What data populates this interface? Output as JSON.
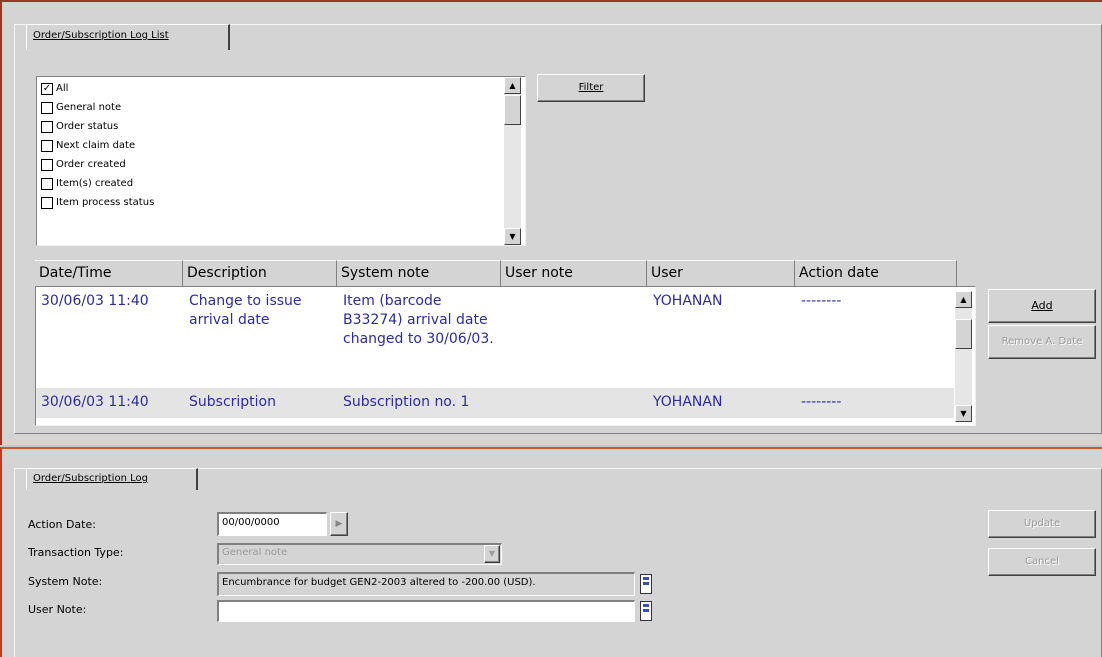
{
  "log_list": {
    "tab_label": "Order/Subscription Log List",
    "filter_button": "Filter",
    "filter_items": [
      {
        "label": "All",
        "checked": true
      },
      {
        "label": "General note",
        "checked": false
      },
      {
        "label": "Order status",
        "checked": false
      },
      {
        "label": "Next claim date",
        "checked": false
      },
      {
        "label": "Order created",
        "checked": false
      },
      {
        "label": "Item(s) created",
        "checked": false
      },
      {
        "label": "Item process status",
        "checked": false
      }
    ],
    "columns": [
      "Date/Time",
      "Description",
      "System note",
      "User note",
      "User",
      "Action date"
    ],
    "rows": [
      {
        "datetime": "30/06/03 11:40",
        "description": "Change to issue arrival date",
        "system_note": "Item (barcode B33274) arrival date changed to 30/06/03.",
        "user_note": "",
        "user": "YOHANAN",
        "action_date": "--------"
      },
      {
        "datetime": "30/06/03 11:40",
        "description": "Subscription",
        "system_note": "Subscription no. 1",
        "user_note": "",
        "user": "YOHANAN",
        "action_date": "--------"
      }
    ],
    "add_button": "Add",
    "remove_button": "Remove A. Date"
  },
  "log_form": {
    "tab_label": "Order/Subscription Log",
    "action_date_label": "Action Date:",
    "action_date_value": "00/00/0000",
    "transaction_type_label": "Transaction Type:",
    "transaction_type_value": "General note",
    "system_note_label": "System Note:",
    "system_note_value": "Encumbrance for budget GEN2-2003 altered to -200.00 (USD).",
    "user_note_label": "User Note:",
    "user_note_value": "",
    "update_button": "Update",
    "cancel_button": "Cancel"
  }
}
